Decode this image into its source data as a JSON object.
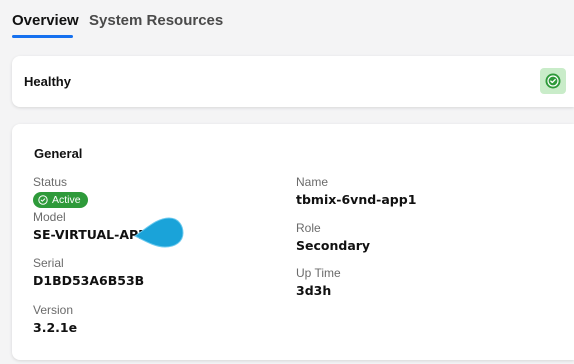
{
  "tabs": {
    "overview": "Overview",
    "system_resources": "System Resources"
  },
  "health": {
    "label": "Healthy",
    "icon": "check-circle-icon",
    "color": "#2e9a3a"
  },
  "general": {
    "title": "General",
    "left": {
      "status_label": "Status",
      "status_value": "Active",
      "model_label": "Model",
      "model_value": "SE-VIRTUAL-APP",
      "serial_label": "Serial",
      "serial_value": "D1BD53A6B53B",
      "version_label": "Version",
      "version_value": "3.2.1e"
    },
    "right": {
      "name_label": "Name",
      "name_value": "tbmix-6vnd-app1",
      "role_label": "Role",
      "role_value": "Secondary",
      "uptime_label": "Up Time",
      "uptime_value": "3d3h"
    }
  },
  "colors": {
    "accent": "#1570ef",
    "status_active": "#2e9a3a",
    "cursor": "#1aa3d9"
  }
}
